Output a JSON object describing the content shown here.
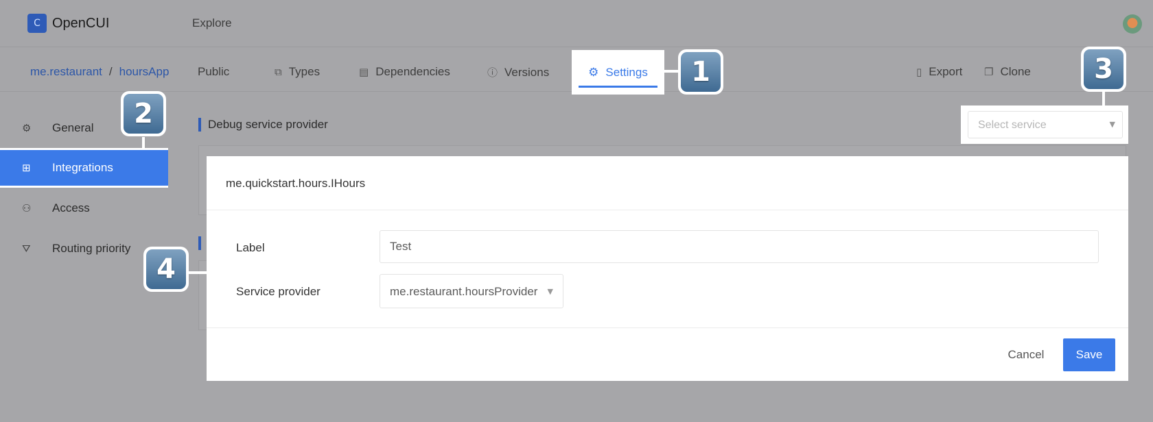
{
  "app": {
    "name": "OpenCUI",
    "logo_glyph": "C"
  },
  "topbar": {
    "explore": "Explore"
  },
  "breadcrumb": {
    "org": "me.restaurant",
    "separator": "/",
    "project": "hoursApp"
  },
  "nav": {
    "public": "Public",
    "types": "Types",
    "dependencies": "Dependencies",
    "versions": "Versions",
    "settings": "Settings",
    "export": "Export",
    "clone": "Clone"
  },
  "sidebar": {
    "items": [
      {
        "label": "General",
        "icon": "gear-icon",
        "active": false
      },
      {
        "label": "Integrations",
        "icon": "grid-icon",
        "active": true
      },
      {
        "label": "Access",
        "icon": "users-icon",
        "active": false
      },
      {
        "label": "Routing priority",
        "icon": "filter-icon",
        "active": false
      }
    ]
  },
  "content": {
    "section_title": "Debug service provider",
    "select_service_placeholder": "Select service"
  },
  "modal": {
    "title": "me.quickstart.hours.IHours",
    "label_field_label": "Label",
    "label_field_value": "Test",
    "service_provider_label": "Service provider",
    "service_provider_value": "me.restaurant.hoursProvider",
    "cancel": "Cancel",
    "save": "Save"
  },
  "callouts": [
    "1",
    "2",
    "3",
    "4"
  ],
  "colors": {
    "accent": "#3b7ae8",
    "brand": "#2e5bb7",
    "overlay": "#a6a6a9"
  }
}
